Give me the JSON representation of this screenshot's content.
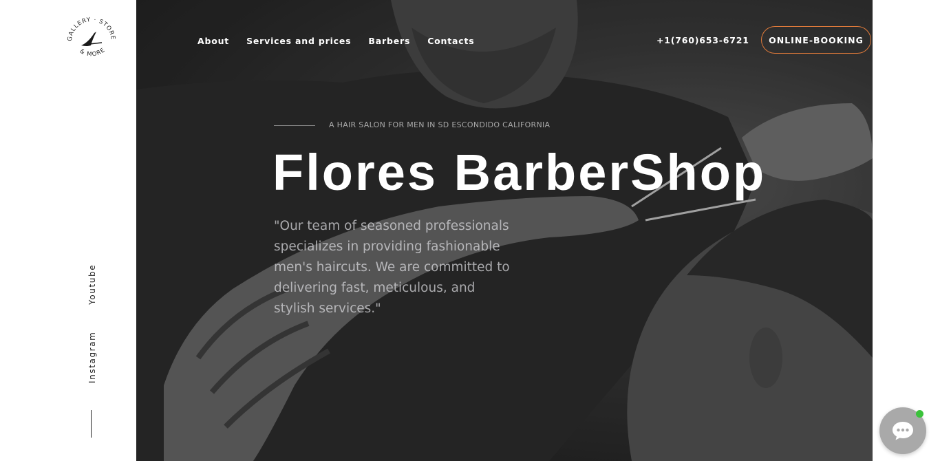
{
  "logo": {
    "text_top": "GALLERY · STORE ·",
    "text_bottom": "& MORE"
  },
  "sidebar": {
    "social": [
      {
        "label": "Youtube"
      },
      {
        "label": "Instagram"
      }
    ]
  },
  "nav": {
    "items": [
      {
        "label": "About"
      },
      {
        "label": "Services and prices"
      },
      {
        "label": "Barbers"
      },
      {
        "label": "Contacts"
      }
    ],
    "phone": "+1(760)653-6721",
    "booking_label": "ONLINE-BOOKING"
  },
  "hero": {
    "tagline": "A HAIR SALON FOR MEN IN SD ESCONDIDO CALIFORNIA",
    "title": "Flores BarberShop",
    "description": "\"Our team of seasoned professionals specializes in providing fashionable men's haircuts. We are committed to delivering fast, meticulous, and stylish services.\""
  },
  "colors": {
    "accent": "#e07a3a",
    "online_dot": "#3bc23b"
  },
  "icons": {
    "logo": "razor-icon",
    "chat": "chat-bubble-icon"
  }
}
